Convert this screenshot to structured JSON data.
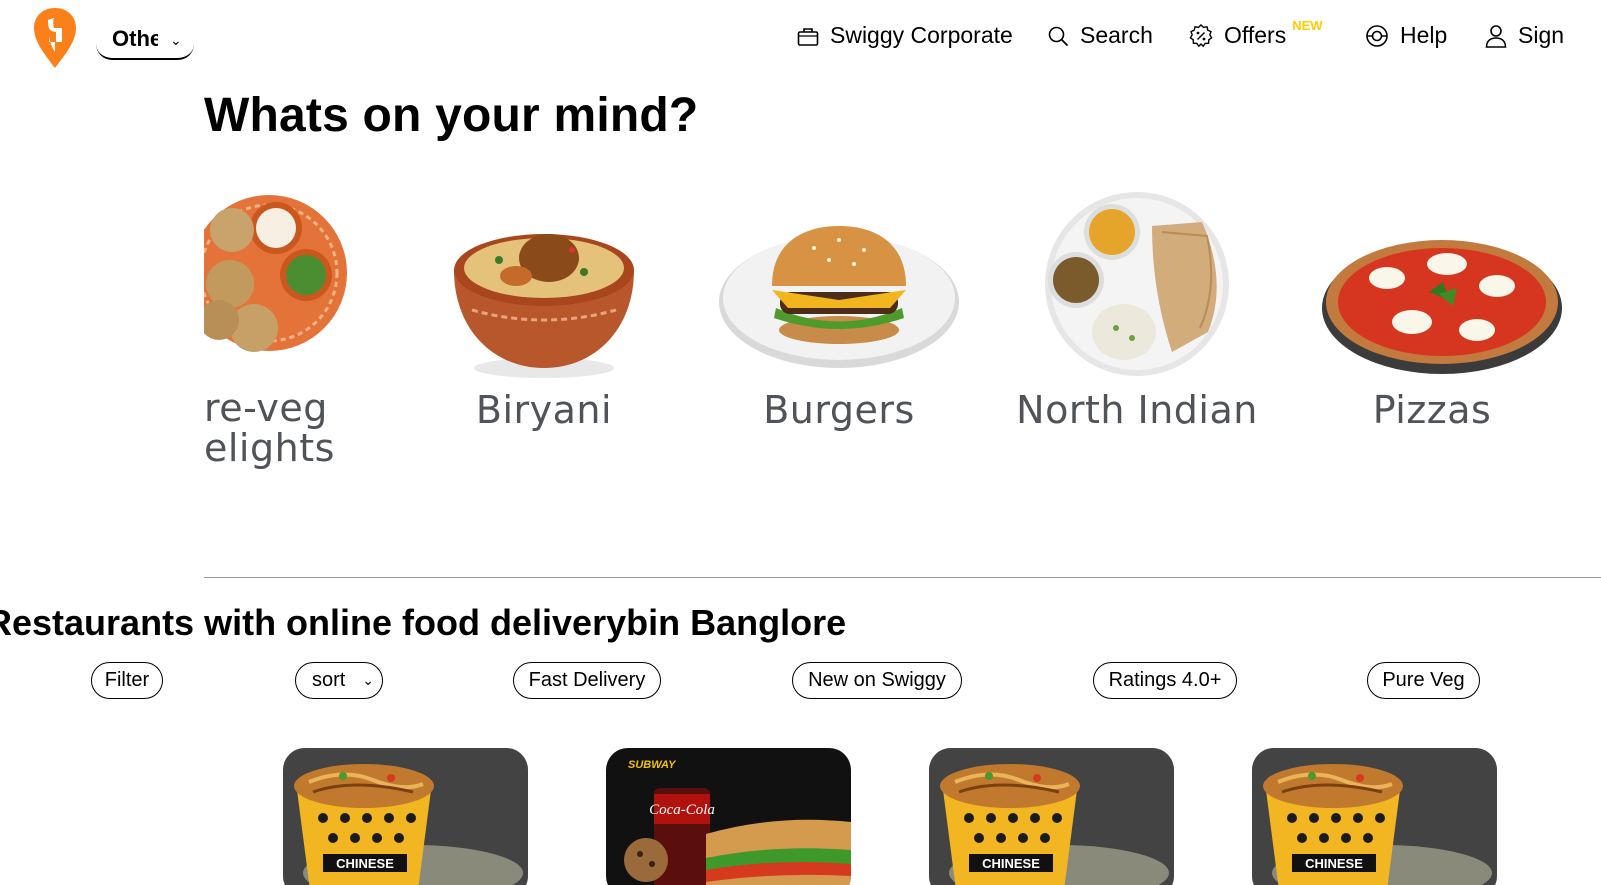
{
  "header": {
    "location_label": "Othe",
    "nav": {
      "corporate": "Swiggy Corporate",
      "search": "Search",
      "offers": "Offers",
      "offers_badge": "NEW",
      "help": "Help",
      "sign": "Sign"
    },
    "brand_color": "#fc8019",
    "badge_color": "#ffcc00"
  },
  "mind": {
    "title": "Whats on your mind?",
    "categories": [
      {
        "label_line1": "re-veg",
        "label_line2": "elights",
        "image": "pure-veg-plate-icon"
      },
      {
        "label": "Biryani",
        "image": "biryani-bowl-icon"
      },
      {
        "label": "Burgers",
        "image": "burger-plate-icon"
      },
      {
        "label": "North Indian",
        "image": "thali-plate-icon"
      },
      {
        "label": "Pizzas",
        "image": "pizza-icon"
      }
    ]
  },
  "restaurants": {
    "title": "Restaurants with online food deliverybin Banglore",
    "filters": {
      "filter": "Filter",
      "sort": "sort",
      "fast_delivery": "Fast Delivery",
      "new_on_swiggy": "New on Swiggy",
      "ratings": "Ratings 4.0+",
      "pure_veg": "Pure Veg"
    },
    "cards": [
      {
        "image": "chinese-noodles-bucket-image",
        "brand_text": "CHINESE"
      },
      {
        "image": "subway-combo-image",
        "brand_text": "SUBWAY",
        "drink_text": "Coca-Cola"
      },
      {
        "image": "chinese-noodles-bucket-image",
        "brand_text": "CHINESE"
      },
      {
        "image": "chinese-noodles-bucket-image",
        "brand_text": "CHINESE"
      }
    ]
  }
}
